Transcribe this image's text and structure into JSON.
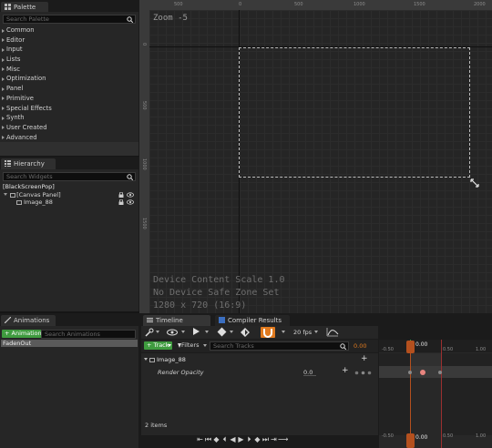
{
  "palette": {
    "tab_label": "Palette",
    "search_placeholder": "Search Palette",
    "categories": [
      "Common",
      "Editor",
      "Input",
      "Lists",
      "Misc",
      "Optimization",
      "Panel",
      "Primitive",
      "Special Effects",
      "Synth",
      "User Created",
      "Advanced"
    ]
  },
  "hierarchy": {
    "tab_label": "Hierarchy",
    "search_placeholder": "Search Widgets",
    "items": [
      "[BlackScreenPop]",
      "[Canvas Panel]",
      "Image_88"
    ]
  },
  "designer": {
    "zoom": "Zoom -5",
    "ruler_top": [
      "0",
      "500",
      "1000",
      "1500",
      "2000"
    ],
    "ruler_left": [
      "0",
      "500",
      "1000",
      "1500"
    ],
    "info_lines": [
      "Device Content Scale 1.0",
      "No Device Safe Zone Set",
      "1280 x 720 (16:9)"
    ]
  },
  "animations": {
    "tab_label": "Animations",
    "add_label": "+ Animation",
    "search_placeholder": "Search Animations",
    "items": [
      "FadenOut"
    ]
  },
  "timeline": {
    "tab_label": "Timeline",
    "compiler_tab_label": "Compiler Results",
    "fps": "20 fps",
    "track_label": "+ Track",
    "filters_label": "Filters",
    "search_placeholder": "Search Tracks",
    "time_value": "0.00",
    "track_name": "Image_88",
    "property_name": "Render Opacity",
    "property_value": "0.0",
    "item_count": "2 items",
    "ruler_labels": [
      "-0.50",
      "0.50",
      "1.00"
    ],
    "playhead_label": "0.00"
  },
  "colors": {
    "accent_orange": "#e07a1f",
    "add_green": "#3f9b3f",
    "playhead": "#b4501e",
    "selection_dash": "#bcbcbc"
  }
}
